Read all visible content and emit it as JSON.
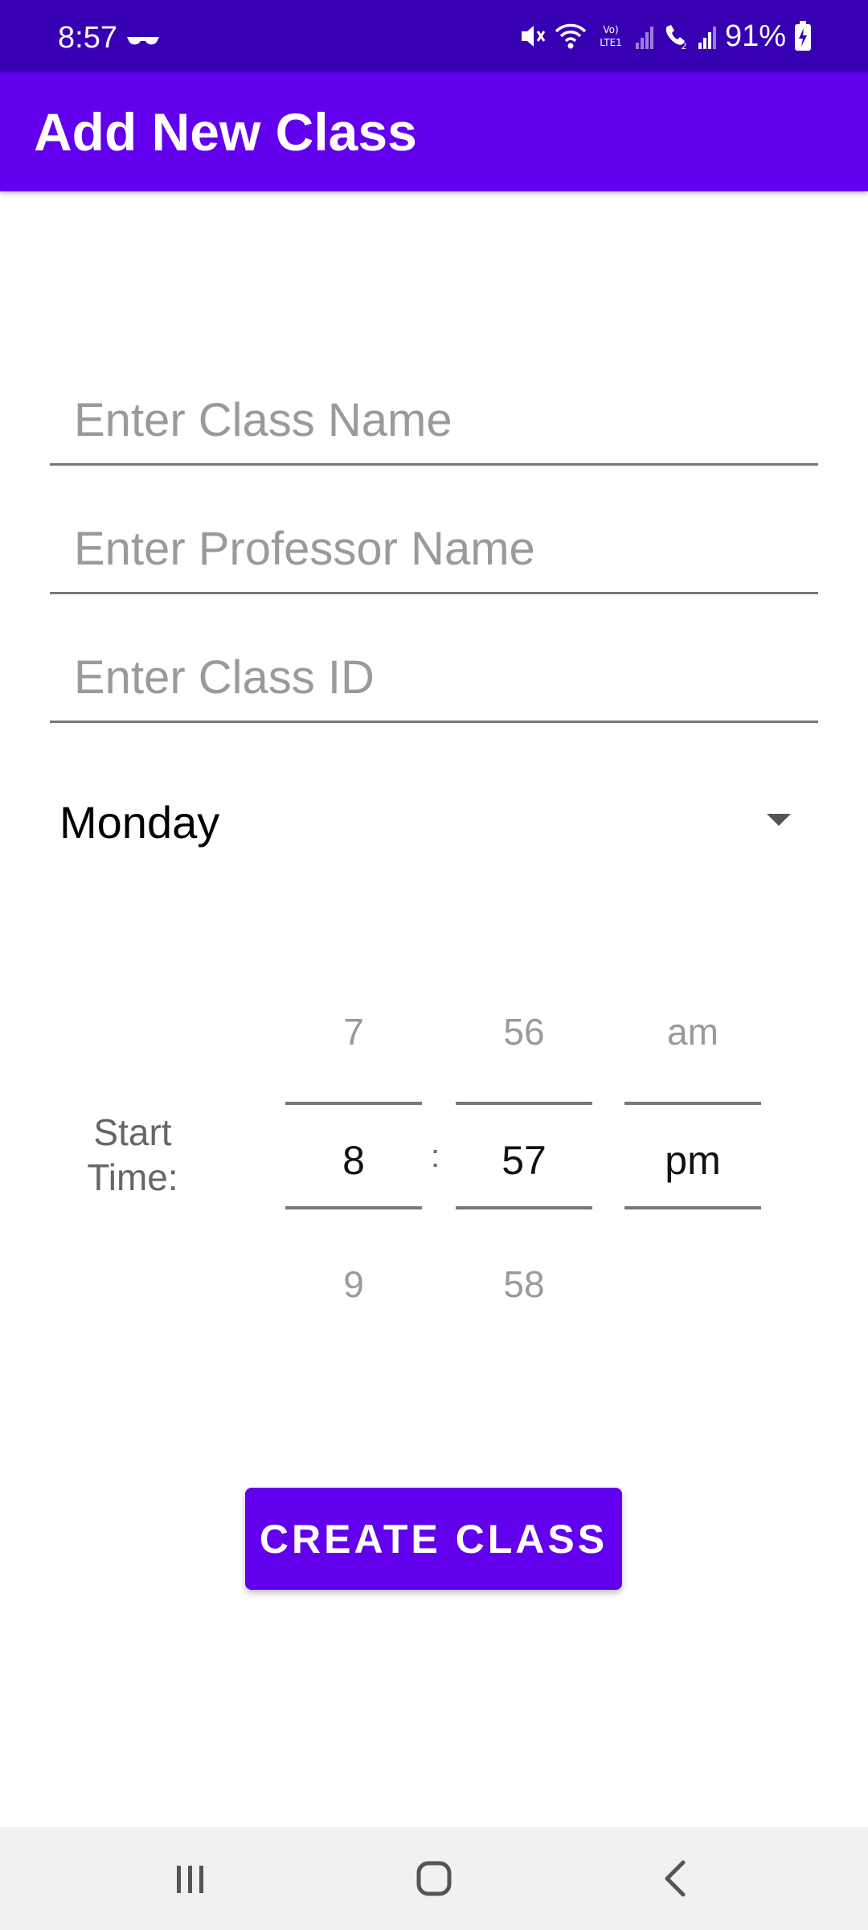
{
  "status_bar": {
    "time": "8:57",
    "battery_percent": "91%",
    "icons": [
      "glasses-icon",
      "mute-icon",
      "wifi-icon",
      "volte-lte-icon",
      "signal-icon",
      "wifi-calling-icon",
      "signal-icon",
      "battery-charging-icon"
    ],
    "bg_color": "#3700B3"
  },
  "app_bar": {
    "title": "Add New Class",
    "bg_color": "#6200EE"
  },
  "form": {
    "class_name": {
      "value": "",
      "placeholder": "Enter Class Name"
    },
    "professor_name": {
      "value": "",
      "placeholder": "Enter Professor Name"
    },
    "class_id": {
      "value": "",
      "placeholder": "Enter Class ID"
    },
    "day_spinner": {
      "selected": "Monday"
    }
  },
  "time_picker": {
    "label": "Start Time:",
    "separator": ":",
    "hour": {
      "prev": "7",
      "selected": "8",
      "next": "9"
    },
    "minute": {
      "prev": "56",
      "selected": "57",
      "next": "58"
    },
    "ampm": {
      "prev": "am",
      "selected": "pm",
      "next": ""
    }
  },
  "create_button": {
    "label": "CREATE CLASS",
    "bg_color": "#6200EE"
  },
  "nav_bar": {
    "buttons": [
      "recent-apps-icon",
      "home-icon",
      "back-icon"
    ]
  }
}
